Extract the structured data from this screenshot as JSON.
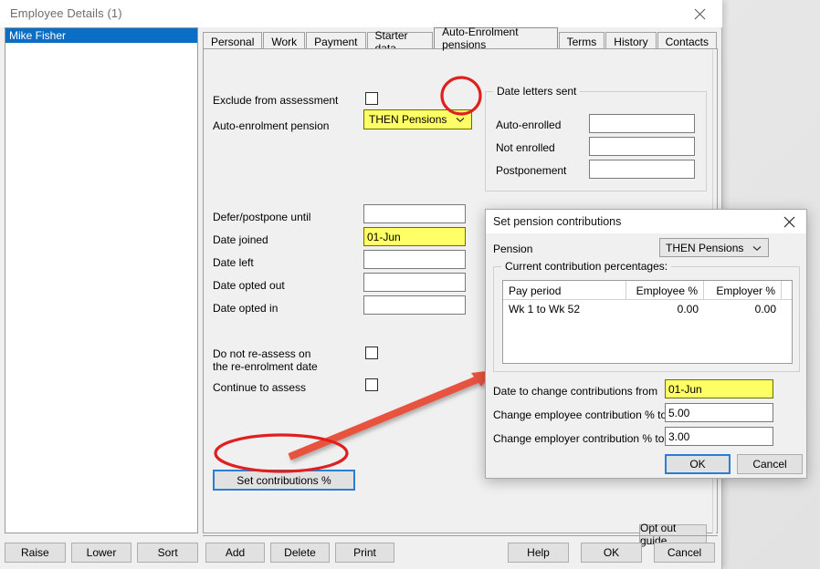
{
  "window": {
    "title": "Employee Details (1)",
    "close_icon": "close-icon"
  },
  "employee_list": {
    "items": [
      {
        "name": "Mike Fisher",
        "selected": true
      }
    ]
  },
  "left_buttons": [
    {
      "label": "Raise",
      "name": "raise-button"
    },
    {
      "label": "Lower",
      "name": "lower-button"
    },
    {
      "label": "Sort",
      "name": "sort-button"
    }
  ],
  "tabs": [
    {
      "label": "Personal",
      "active": false
    },
    {
      "label": "Work",
      "active": false
    },
    {
      "label": "Payment",
      "active": false
    },
    {
      "label": "Starter data",
      "active": false
    },
    {
      "label": "Auto-Enrolment pensions",
      "active": true
    },
    {
      "label": "Terms",
      "active": false
    },
    {
      "label": "History",
      "active": false
    },
    {
      "label": "Contacts",
      "active": false
    }
  ],
  "pensions_tab": {
    "exclude_from_assessment": {
      "label": "Exclude from assessment",
      "checked": false
    },
    "auto_enrolment_pension": {
      "label": "Auto-enrolment pension",
      "value": "THEN Pensions",
      "highlighted": true,
      "arrow_icon": "chevron-down-icon"
    },
    "date_letters_sent": {
      "title": "Date letters sent",
      "fields": [
        {
          "label": "Auto-enrolled",
          "value": ""
        },
        {
          "label": "Not enrolled",
          "value": ""
        },
        {
          "label": "Postponement",
          "value": ""
        }
      ]
    },
    "date_fields": [
      {
        "label": "Defer/postpone until",
        "value": "",
        "highlighted": false
      },
      {
        "label": "Date joined",
        "value": "01-Jun",
        "highlighted": true
      },
      {
        "label": "Date left",
        "value": "",
        "highlighted": false
      },
      {
        "label": "Date opted out",
        "value": "",
        "highlighted": false
      },
      {
        "label": "Date opted in",
        "value": "",
        "highlighted": false
      }
    ],
    "checkboxes": [
      {
        "label": "Do not re-assess on\nthe re-enrolment date",
        "checked": false
      },
      {
        "label": "Continue to assess",
        "checked": false
      }
    ],
    "set_contributions_button": {
      "label": "Set contributions %",
      "focused": true
    },
    "opt_out_guide_button": {
      "label": "Opt out guide"
    }
  },
  "bottom_buttons": [
    {
      "label": "Add",
      "name": "add-button"
    },
    {
      "label": "Delete",
      "name": "delete-button"
    },
    {
      "label": "Print",
      "name": "print-button"
    },
    {
      "label": "Help",
      "name": "help-button"
    },
    {
      "label": "OK",
      "name": "ok-button"
    },
    {
      "label": "Cancel",
      "name": "cancel-button"
    }
  ],
  "dialog": {
    "title": "Set pension contributions",
    "close_icon": "close-icon",
    "pension": {
      "label": "Pension",
      "value": "THEN Pensions",
      "arrow_icon": "chevron-down-icon"
    },
    "group_title": "Current contribution percentages:",
    "grid": {
      "columns": [
        "Pay period",
        "Employee %",
        "Employer %"
      ],
      "rows": [
        {
          "pay_period": "Wk 1 to Wk 52",
          "employee": "0.00",
          "employer": "0.00"
        }
      ]
    },
    "fields": [
      {
        "label": "Date to change contributions from",
        "value": "01-Jun",
        "highlighted": true
      },
      {
        "label": "Change employee contribution % to",
        "value": "5.00",
        "highlighted": false
      },
      {
        "label": "Change employer contribution % to",
        "value": "3.00",
        "highlighted": false
      }
    ],
    "ok_label": "OK",
    "cancel_label": "Cancel"
  },
  "annotations": {
    "accent_red": "#e02020",
    "arrow_red": "#e8523f",
    "focus_blue": "#1a6fc4"
  }
}
